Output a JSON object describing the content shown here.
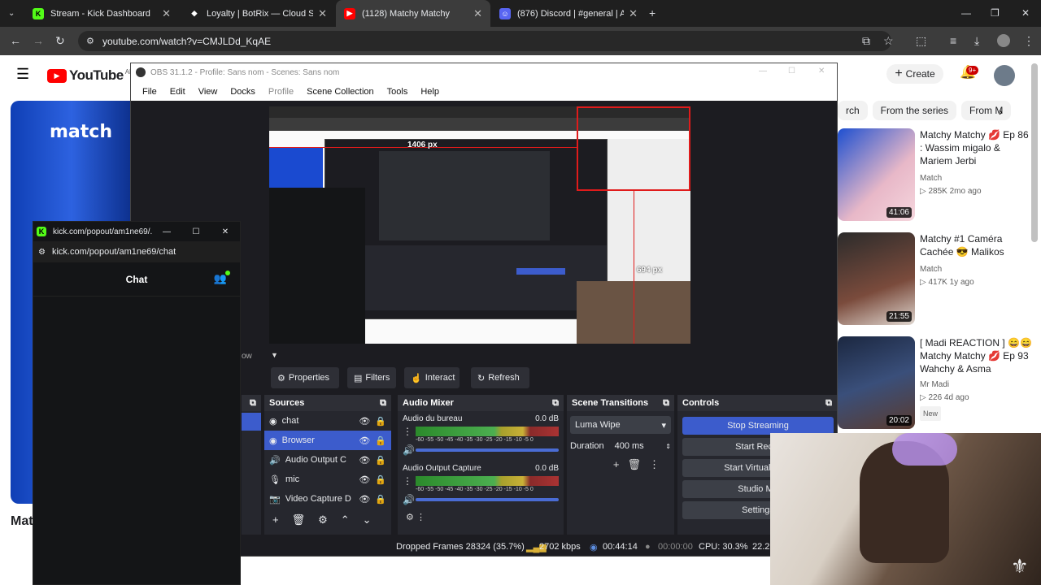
{
  "browser": {
    "tabs": [
      {
        "title": "Stream - Kick Dashboard",
        "color": "#53fc18",
        "glyph": "K"
      },
      {
        "title": "Loyalty | BotRix — Cloud Strean",
        "color": "#ffffff",
        "glyph": "◆"
      },
      {
        "title": "(1128) Matchy Matchy",
        "color": "#ff0000",
        "glyph": "▶"
      },
      {
        "title": "(876) Discord | #general | A",
        "color": "#5865f2",
        "glyph": "☺"
      }
    ],
    "url": "youtube.com/watch?v=CMJLDd_KqAE"
  },
  "youtube": {
    "logo": "YouTube",
    "country": "AE",
    "create": "Create",
    "notif": "9+",
    "chips": [
      "rch",
      "From the series",
      "From M"
    ],
    "video_left_text": "match",
    "partial_title": "Mat",
    "recommended": [
      {
        "title": "Matchy Matchy 💋 Ep 86 : Wassim migalo & Mariem Jerbi",
        "channel": "Match",
        "meta": "▷ 285K  2mo ago",
        "duration": "41:06"
      },
      {
        "title": "Matchy #1 Caméra Cachée 😎 Malikos",
        "channel": "Match",
        "meta": "▷ 417K  1y ago",
        "duration": "21:55"
      },
      {
        "title": "[ Madi REACTION ] 😄😄Matchy Matchy 💋 Ep 93 Wahchy & Asma",
        "channel": "Mr Madi",
        "meta": "▷ 226  4d ago",
        "badge": "New",
        "duration": "20:02"
      }
    ]
  },
  "obs": {
    "title": "OBS 31.1.2 - Profile: Sans nom - Scenes: Sans nom",
    "menu": [
      "File",
      "Edit",
      "View",
      "Docks",
      "Profile",
      "Scene Collection",
      "Tools",
      "Help"
    ],
    "preview_label": "1406 px",
    "preview_label2": "694 px",
    "buttons": [
      "Properties",
      "Filters",
      "Interact",
      "Refresh"
    ],
    "sources_title": "Sources",
    "sources": [
      "chat",
      "Browser",
      "Audio Output C",
      "mic",
      "Video Capture D"
    ],
    "mixer_title": "Audio Mixer",
    "mixer": [
      {
        "name": "Audio du bureau",
        "db": "0.0 dB"
      },
      {
        "name": "Audio Output Capture",
        "db": "0.0 dB"
      }
    ],
    "meter_ticks": "-60 -55 -50 -45 -40 -35 -30 -25 -20 -15 -10 -5  0",
    "transitions_title": "Scene Transitions",
    "transition": "Luma Wipe",
    "duration_label": "Duration",
    "duration": "400 ms",
    "controls_title": "Controls",
    "controls": [
      "Stop Streaming",
      "Start Recor",
      "Start Virtual Cam",
      "Studio Mo",
      "Settings"
    ],
    "status": {
      "dropped": "Dropped Frames 28324 (35.7%)",
      "kbps": "2702 kbps",
      "live": "00:44:14",
      "rec": "00:00:00",
      "cpu": "CPU: 30.3%",
      "fps": "22.2"
    },
    "left_cut": "ow"
  },
  "kick": {
    "title": "kick.com/popout/am1ne69/...",
    "url": "kick.com/popout/am1ne69/chat",
    "chat": "Chat"
  }
}
